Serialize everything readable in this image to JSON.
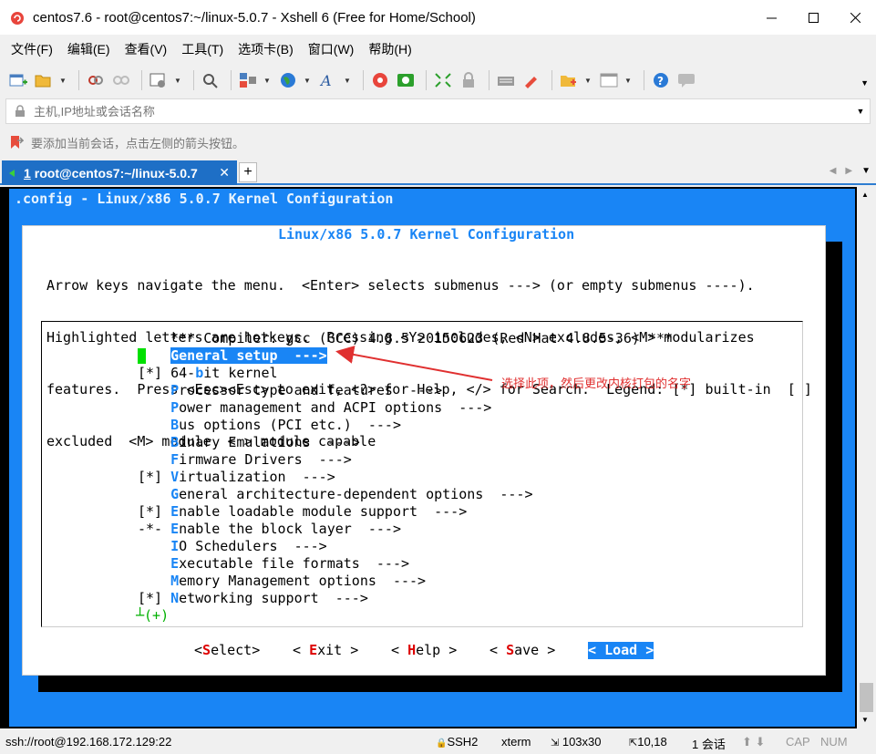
{
  "window": {
    "title": "centos7.6 - root@centos7:~/linux-5.0.7 - Xshell 6 (Free for Home/School)"
  },
  "menu": [
    "文件(F)",
    "编辑(E)",
    "查看(V)",
    "工具(T)",
    "选项卡(B)",
    "窗口(W)",
    "帮助(H)"
  ],
  "address_bar": {
    "placeholder": "主机,IP地址或会话名称"
  },
  "hint": "要添加当前会话，点击左侧的箭头按钮。",
  "tab": {
    "number": "1",
    "label": "root@centos7:~/linux-5.0.7"
  },
  "terminal": {
    "config_title": ".config - Linux/x86 5.0.7 Kernel Configuration",
    "dialog_title": "Linux/x86 5.0.7 Kernel Configuration",
    "help_lines": [
      "Arrow keys navigate the menu.  <Enter> selects submenus ---> (or empty submenus ----).",
      "Highlighted letters are hotkeys.  Pressing <Y> includes, <N> excludes, <M> modularizes",
      "features.  Press <Esc><Esc> to exit, <?> for Help, </> for Search.  Legend: [*] built-in  [ ]",
      "excluded  <M> module  < > module capable"
    ],
    "menu_items": [
      {
        "prefix": "    ",
        "hotkey": "",
        "text": "*** Compiler: gcc (GCC) 4.8.5 20150623 (Red Hat 4.8.5-36) ***"
      },
      {
        "prefix": "    ",
        "hotkey": "G",
        "text": "eneral setup  --->"
      },
      {
        "prefix": "[*] ",
        "hotkey": "",
        "text": "64-",
        "hotkey2": "b",
        "text2": "it kernel"
      },
      {
        "prefix": "    ",
        "hotkey": "P",
        "text": "rocessor type and features  --->"
      },
      {
        "prefix": "    ",
        "hotkey": "P",
        "text": "ower management and ACPI options  --->"
      },
      {
        "prefix": "    ",
        "hotkey": "B",
        "text": "us options (PCI etc.)  --->"
      },
      {
        "prefix": "    ",
        "hotkey": "B",
        "text": "inary Emulations  --->"
      },
      {
        "prefix": "    ",
        "hotkey": "F",
        "text": "irmware Drivers  --->"
      },
      {
        "prefix": "[*] ",
        "hotkey": "V",
        "text": "irtualization  --->"
      },
      {
        "prefix": "    ",
        "hotkey": "G",
        "text": "eneral architecture-dependent options  --->"
      },
      {
        "prefix": "[*] ",
        "hotkey": "E",
        "text": "nable loadable module support  --->"
      },
      {
        "prefix": "-*- ",
        "hotkey": "E",
        "text": "nable the block layer  --->"
      },
      {
        "prefix": "    ",
        "hotkey": "I",
        "text": "O Schedulers  --->"
      },
      {
        "prefix": "    ",
        "hotkey": "E",
        "text": "xecutable file formats  --->"
      },
      {
        "prefix": "    ",
        "hotkey": "M",
        "text": "emory Management options  --->"
      },
      {
        "prefix": "[*] ",
        "hotkey": "N",
        "text": "etworking support  --->"
      }
    ],
    "more_indicator": "(+)",
    "buttons": [
      {
        "pre": "<",
        "hotkey": "S",
        "rest": "elect>"
      },
      {
        "pre": "< ",
        "hotkey": "E",
        "rest": "xit >"
      },
      {
        "pre": "< ",
        "hotkey": "H",
        "rest": "elp >"
      },
      {
        "pre": "< ",
        "hotkey": "S",
        "rest": "ave >"
      },
      {
        "pre": "< ",
        "hotkey": "L",
        "rest": "oad >"
      }
    ]
  },
  "annotation": "选择此项，然后更改内核打包的名字",
  "status": {
    "connection": "ssh://root@192.168.172.129:22",
    "protocol": "SSH2",
    "term_type": "xterm",
    "size": "103x30",
    "cursor_pos": "10,18",
    "sessions": "1 会话",
    "cap": "CAP",
    "num": "NUM"
  },
  "colors": {
    "terminal_blue": "#1985f5",
    "tab_blue": "#1e6fc6",
    "annotation_red": "#e03030",
    "cursor_green": "#00e000"
  }
}
